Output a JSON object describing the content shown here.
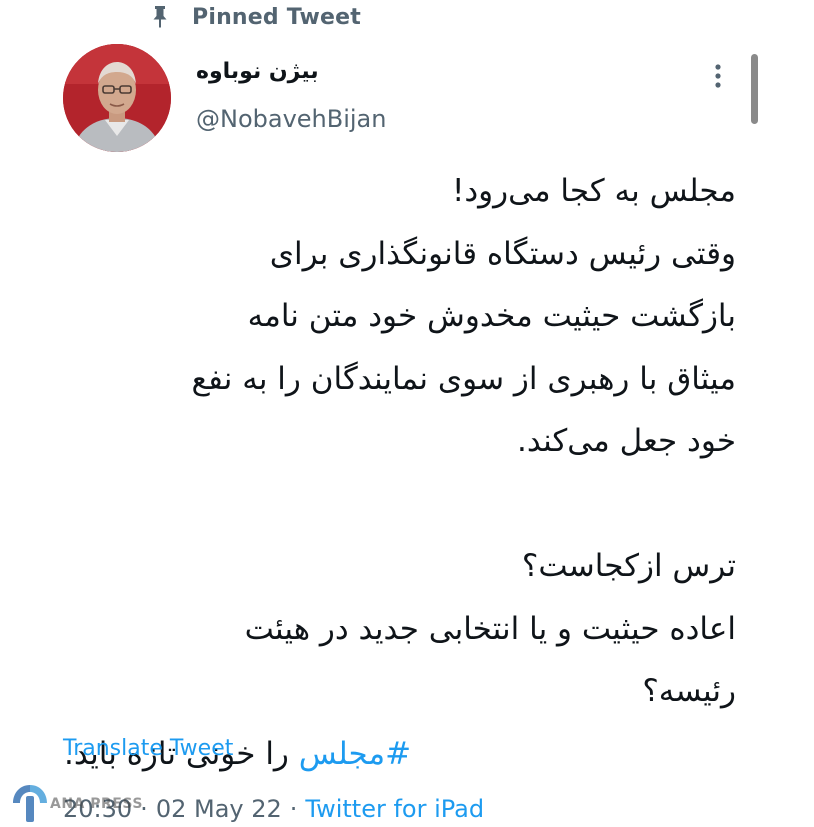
{
  "pinned": {
    "icon": "pin-icon",
    "label": "Pinned Tweet"
  },
  "author": {
    "display_name": "بیژن نوباوه",
    "handle": "@NobavehBijan",
    "avatar": "profile-photo"
  },
  "menu": {
    "icon": "more-options-icon"
  },
  "tweet": {
    "lines": [
      "مجلس به کجا می‌رود!",
      "وقتی رئیس دستگاه قانونگذاری برای",
      "بازگشت حیثیت مخدوش خود متن نامه",
      "میثاق با رهبری از سوی نمایندگان را به نفع",
      "خود جعل می‌کند.",
      "",
      "ترس ازکجاست؟",
      "اعاده حیثیت و یا انتخابی جدید در هیئت",
      "رئیسه؟"
    ],
    "hashtag": "#مجلس",
    "hashtag_rest": " را خونی تازه باید."
  },
  "translate_label": "Translate Tweet",
  "meta": {
    "time": "20:30",
    "separator": "·",
    "date": "02 May 22",
    "source": "Twitter for iPad"
  },
  "watermark": {
    "text": "ANA PRESS",
    "logo": "ana-press-logo"
  },
  "colors": {
    "link": "#1d9bf0",
    "secondary_text": "#536471",
    "primary_text": "#0f1419",
    "background": "#ffffff"
  }
}
